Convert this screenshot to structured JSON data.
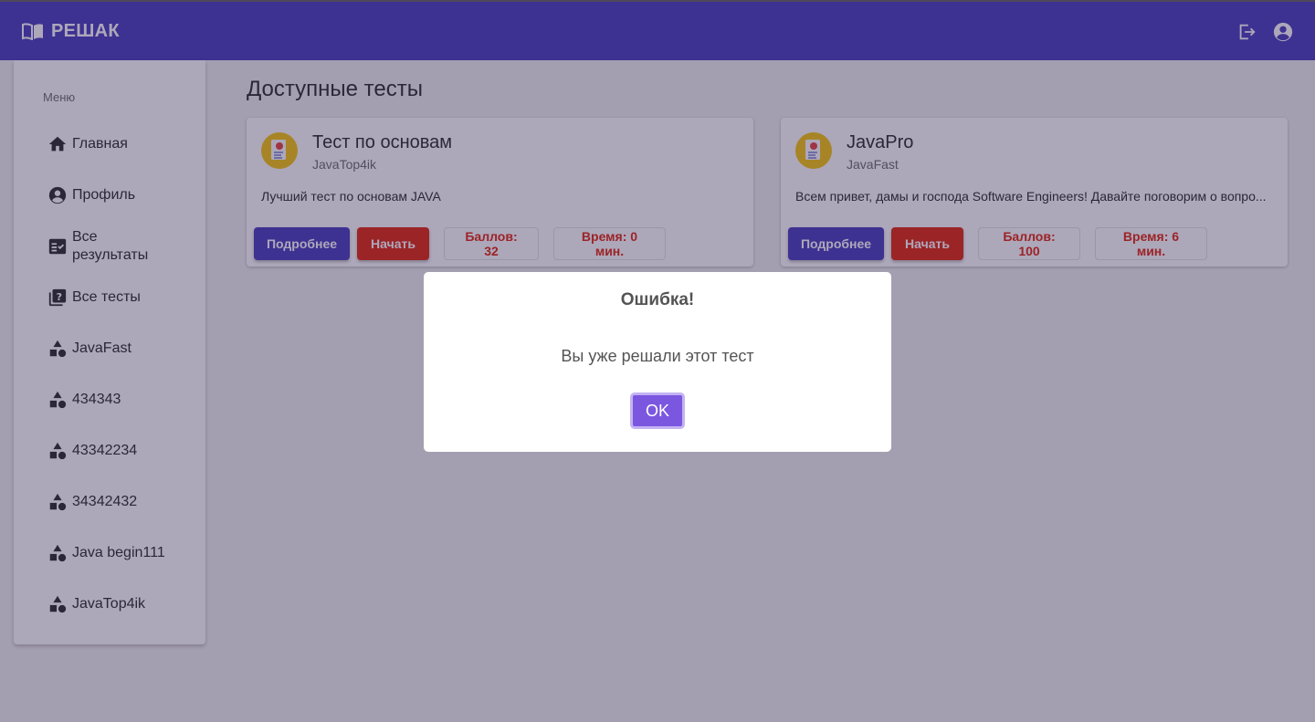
{
  "app": {
    "title": "РЕШАК"
  },
  "sidebar": {
    "heading": "Меню",
    "items": [
      {
        "label": "Главная",
        "icon": "home-icon"
      },
      {
        "label": "Профиль",
        "icon": "account-circle-icon"
      },
      {
        "label": "Все\nрезультаты",
        "icon": "fact-check-icon"
      },
      {
        "label": "Все тесты",
        "icon": "quiz-icon"
      },
      {
        "label": "JavaFast",
        "icon": "category-icon"
      },
      {
        "label": "434343",
        "icon": "category-icon"
      },
      {
        "label": "43342234",
        "icon": "category-icon"
      },
      {
        "label": "34342432",
        "icon": "category-icon"
      },
      {
        "label": "Java begin111",
        "icon": "category-icon"
      },
      {
        "label": "JavaTop4ik",
        "icon": "category-icon"
      }
    ]
  },
  "main": {
    "title": "Доступные тесты",
    "cards": [
      {
        "title": "Тест по основам",
        "author": "JavaTop4ik",
        "description": "Лучший тест по основам JAVA",
        "details_label": "Подробнее",
        "start_label": "Начать",
        "score_label": "Баллов: 32",
        "time_label": "Время: 0 мин."
      },
      {
        "title": "JavaPro",
        "author": "JavaFast",
        "description": "Всем привет, дамы и господа Software Engineers! Давайте поговорим о вопро...",
        "details_label": "Подробнее",
        "start_label": "Начать",
        "score_label": "Баллов: 100",
        "time_label": "Время: 6 мин."
      }
    ]
  },
  "dialog": {
    "title": "Ошибка!",
    "message": "Вы уже решали этот тест",
    "ok_label": "OK"
  },
  "colors": {
    "appbar": "#3f35b8",
    "primary_button": "#3f35b8",
    "start_button": "#e11e00",
    "dialog_ok": "#7b57e0",
    "avatar": "#f5c400"
  }
}
